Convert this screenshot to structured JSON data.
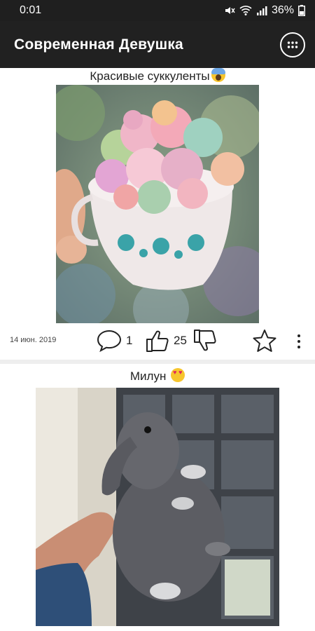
{
  "status_bar": {
    "time": "0:01",
    "battery": "36%",
    "icons": [
      "mute-icon",
      "wifi-icon",
      "signal-icon",
      "battery-icon"
    ]
  },
  "app_bar": {
    "title": "Современная Девушка",
    "menu_icon": "grid-menu-icon"
  },
  "posts": [
    {
      "title": "Красивые суккуленты",
      "title_emoji": "screaming-face-emoji",
      "image": "succulents-in-teacup",
      "date": "14 июн. 2019",
      "comments": "1",
      "likes": "25"
    },
    {
      "title": "Милун",
      "title_emoji": "heart-eyes-emoji",
      "image": "grey-bunny-held-in-hand"
    }
  ],
  "colors": {
    "app_bar": "#212121",
    "status_bar": "#1f1f1f",
    "background": "#ffffff",
    "divider": "#eeeeee"
  }
}
